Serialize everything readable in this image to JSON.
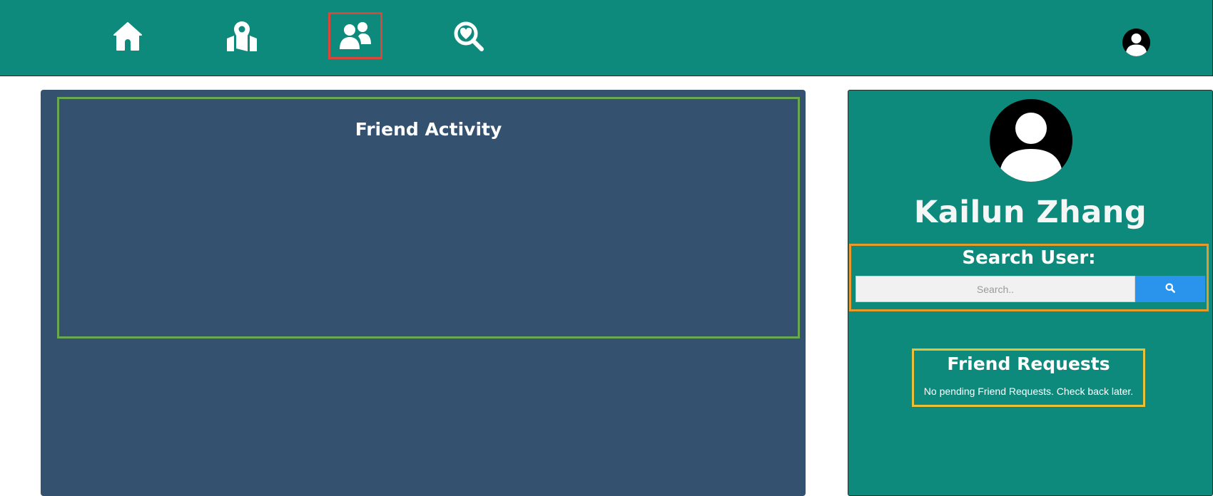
{
  "nav": {
    "items": [
      {
        "icon": "home-icon",
        "active": false
      },
      {
        "icon": "map-pin-icon",
        "active": false
      },
      {
        "icon": "friends-icon",
        "active": true
      },
      {
        "icon": "search-heart-icon",
        "active": false
      }
    ],
    "account_icon": "user-avatar-icon"
  },
  "activity": {
    "title": "Friend Activity"
  },
  "profile": {
    "name": "Kailun Zhang"
  },
  "search": {
    "label": "Search User:",
    "placeholder": "Search..",
    "value": ""
  },
  "requests": {
    "title": "Friend Requests",
    "message": "No pending Friend Requests. Check back later."
  },
  "colors": {
    "header": "#0e8a7d",
    "activity_panel": "#34516f",
    "activity_border": "#6aa84f",
    "search_border": "#e59a2b",
    "requests_border": "#e8c13a",
    "active_nav_border": "#d9463a",
    "search_button": "#2a93eb"
  }
}
